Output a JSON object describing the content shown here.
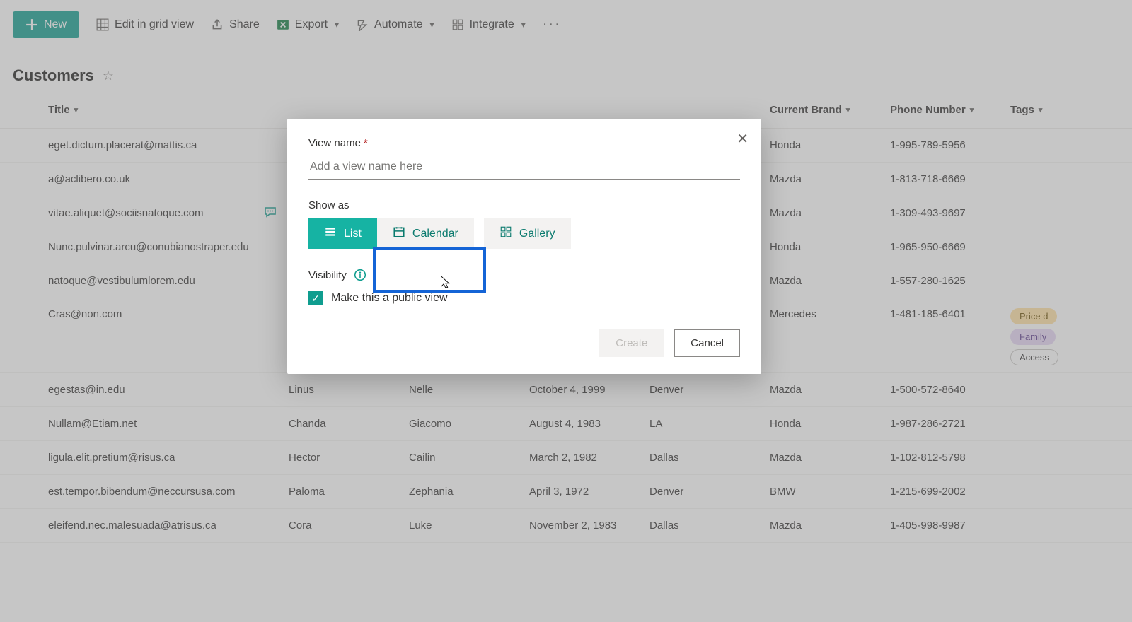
{
  "commandbar": {
    "new": "New",
    "edit_grid": "Edit in grid view",
    "share": "Share",
    "export": "Export",
    "automate": "Automate",
    "integrate": "Integrate"
  },
  "page": {
    "title": "Customers"
  },
  "columns": {
    "c0": "",
    "c1": "Title",
    "c2": "",
    "c3": "",
    "c4": "",
    "c5": "",
    "c6": "Current Brand",
    "c7": "Phone Number",
    "c8": "Tags"
  },
  "rows": [
    {
      "title": "eget.dictum.placerat@mattis.ca",
      "first": "",
      "last": "",
      "date": "",
      "city": "",
      "brand": "Honda",
      "phone": "1-995-789-5956",
      "comment": false,
      "tags": []
    },
    {
      "title": "a@aclibero.co.uk",
      "first": "",
      "last": "",
      "date": "",
      "city": "",
      "brand": "Mazda",
      "phone": "1-813-718-6669",
      "comment": false,
      "tags": []
    },
    {
      "title": "vitae.aliquet@sociisnatoque.com",
      "first": "",
      "last": "",
      "date": "",
      "city": "",
      "brand": "Mazda",
      "phone": "1-309-493-9697",
      "comment": true,
      "tags": []
    },
    {
      "title": "Nunc.pulvinar.arcu@conubianostraper.edu",
      "first": "",
      "last": "",
      "date": "",
      "city": "",
      "brand": "Honda",
      "phone": "1-965-950-6669",
      "comment": false,
      "tags": []
    },
    {
      "title": "natoque@vestibulumlorem.edu",
      "first": "",
      "last": "",
      "date": "",
      "city": "",
      "brand": "Mazda",
      "phone": "1-557-280-1625",
      "comment": false,
      "tags": []
    },
    {
      "title": "Cras@non.com",
      "first": "",
      "last": "",
      "date": "",
      "city": "",
      "brand": "Mercedes",
      "phone": "1-481-185-6401",
      "comment": false,
      "tags": [
        "Price d",
        "Family",
        "Access"
      ],
      "tall": true
    },
    {
      "title": "egestas@in.edu",
      "first": "Linus",
      "last": "Nelle",
      "date": "October 4, 1999",
      "city": "Denver",
      "brand": "Mazda",
      "phone": "1-500-572-8640",
      "comment": false,
      "tags": []
    },
    {
      "title": "Nullam@Etiam.net",
      "first": "Chanda",
      "last": "Giacomo",
      "date": "August 4, 1983",
      "city": "LA",
      "brand": "Honda",
      "phone": "1-987-286-2721",
      "comment": false,
      "tags": []
    },
    {
      "title": "ligula.elit.pretium@risus.ca",
      "first": "Hector",
      "last": "Cailin",
      "date": "March 2, 1982",
      "city": "Dallas",
      "brand": "Mazda",
      "phone": "1-102-812-5798",
      "comment": false,
      "tags": []
    },
    {
      "title": "est.tempor.bibendum@neccursusa.com",
      "first": "Paloma",
      "last": "Zephania",
      "date": "April 3, 1972",
      "city": "Denver",
      "brand": "BMW",
      "phone": "1-215-699-2002",
      "comment": false,
      "tags": []
    },
    {
      "title": "eleifend.nec.malesuada@atrisus.ca",
      "first": "Cora",
      "last": "Luke",
      "date": "November 2, 1983",
      "city": "Dallas",
      "brand": "Mazda",
      "phone": "1-405-998-9987",
      "comment": false,
      "tags": []
    }
  ],
  "tag_colors": [
    "orange",
    "purple",
    "white"
  ],
  "modal": {
    "view_name_label": "View name",
    "view_name_placeholder": "Add a view name here",
    "show_as_label": "Show as",
    "opt_list": "List",
    "opt_calendar": "Calendar",
    "opt_gallery": "Gallery",
    "visibility_label": "Visibility",
    "public_label": "Make this a public view",
    "create": "Create",
    "cancel": "Cancel"
  }
}
